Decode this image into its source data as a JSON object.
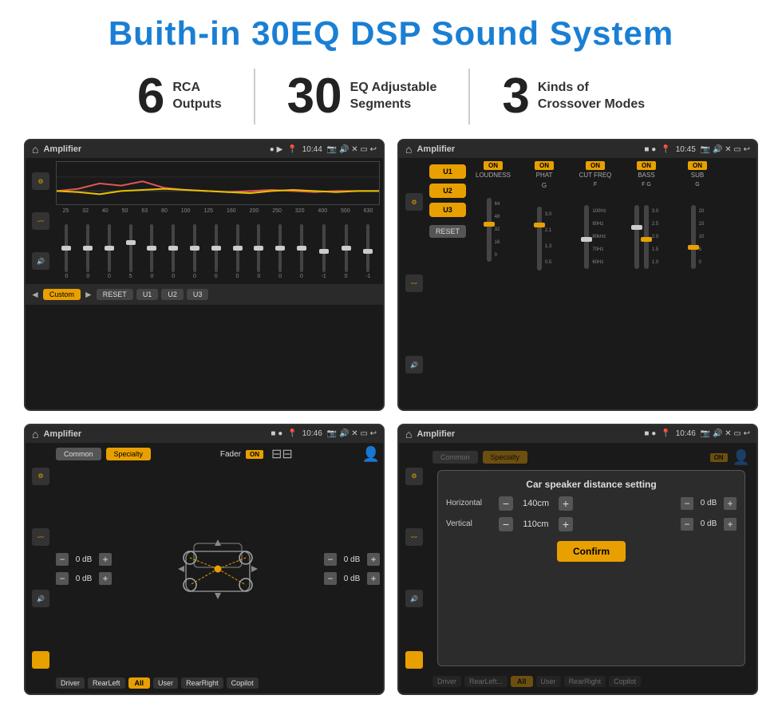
{
  "title": "Buith-in 30EQ DSP Sound System",
  "stats": [
    {
      "number": "6",
      "text": "RCA\nOutputs"
    },
    {
      "number": "30",
      "text": "EQ Adjustable\nSegments"
    },
    {
      "number": "3",
      "text": "Kinds of\nCrossover Modes"
    }
  ],
  "screens": {
    "eq": {
      "topbar": {
        "title": "Amplifier",
        "time": "10:44"
      },
      "freqs": [
        "25",
        "32",
        "40",
        "50",
        "63",
        "80",
        "100",
        "125",
        "160",
        "200",
        "250",
        "320",
        "400",
        "500",
        "630"
      ],
      "sliders": [
        0,
        0,
        0,
        5,
        0,
        0,
        0,
        0,
        0,
        0,
        0,
        0,
        -1,
        0,
        -1
      ],
      "presets": [
        "Custom",
        "RESET",
        "U1",
        "U2",
        "U3"
      ]
    },
    "crossover": {
      "topbar": {
        "title": "Amplifier",
        "time": "10:45"
      },
      "presets": [
        "U1",
        "U2",
        "U3"
      ],
      "channels": [
        {
          "name": "LOUDNESS",
          "on": true
        },
        {
          "name": "PHAT",
          "on": true
        },
        {
          "name": "CUT FREQ",
          "on": true
        },
        {
          "name": "BASS",
          "on": true
        },
        {
          "name": "SUB",
          "on": true
        }
      ],
      "reset": "RESET"
    },
    "fader": {
      "topbar": {
        "title": "Amplifier",
        "time": "10:46"
      },
      "tabs": [
        "Common",
        "Specialty"
      ],
      "fader_label": "Fader",
      "on_text": "ON",
      "db_values": [
        "0 dB",
        "0 dB",
        "0 dB",
        "0 dB"
      ],
      "bottom_buttons": [
        "Driver",
        "RearLeft",
        "All",
        "User",
        "RearRight",
        "Copilot"
      ]
    },
    "distance": {
      "topbar": {
        "title": "Amplifier",
        "time": "10:46"
      },
      "tabs": [
        "Common",
        "Specialty"
      ],
      "on_text": "ON",
      "dialog": {
        "title": "Car speaker distance setting",
        "horizontal_label": "Horizontal",
        "horizontal_value": "140cm",
        "vertical_label": "Vertical",
        "vertical_value": "110cm",
        "db_value": "0 dB",
        "db_value2": "0 dB",
        "confirm_label": "Confirm"
      },
      "bottom_buttons": [
        "Driver",
        "RearLeft",
        "All",
        "User",
        "RearRight",
        "Copilot"
      ]
    }
  }
}
